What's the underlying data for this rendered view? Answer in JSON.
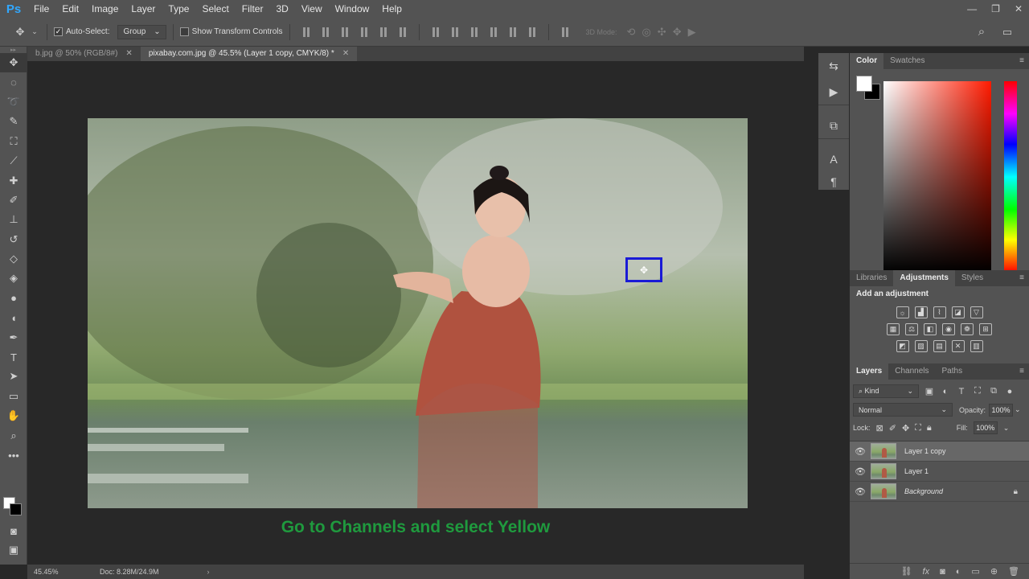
{
  "app": {
    "logo": "Ps"
  },
  "menubar": {
    "items": [
      "File",
      "Edit",
      "Image",
      "Layer",
      "Type",
      "Select",
      "Filter",
      "3D",
      "View",
      "Window",
      "Help"
    ]
  },
  "window_controls": {
    "minimize": "—",
    "restore": "❐",
    "close": "✕"
  },
  "options_bar": {
    "move_tool_icon": "✥",
    "auto_select_label": "Auto-Select:",
    "auto_select_checked": true,
    "auto_select_mode": "Group",
    "show_transform_label": "Show Transform Controls",
    "show_transform_checked": false,
    "mode_3d_label": "3D Mode:"
  },
  "tabs": [
    {
      "title": "b.jpg @ 50% (RGB/8#)",
      "close": "✕",
      "active": false
    },
    {
      "title": "pixabay.com.jpg @ 45.5% (Layer 1 copy, CMYK/8) *",
      "close": "✕",
      "active": true
    }
  ],
  "canvas": {
    "caption": "Go to Channels and select Yellow",
    "caption_color": "#1f9a3e",
    "marker_color": "#1a1ad6"
  },
  "statusbar": {
    "zoom": "45.45%",
    "doc": "Doc: 8.28M/24.9M",
    "arrow": "›"
  },
  "color_panel": {
    "tabs": [
      "Color",
      "Swatches"
    ],
    "active": "Color",
    "foreground": "#ffffff",
    "background": "#000000",
    "hue": "#ff1a00"
  },
  "adjustments_panel": {
    "tabs": [
      "Libraries",
      "Adjustments",
      "Styles"
    ],
    "active": "Adjustments",
    "title": "Add an adjustment"
  },
  "layers_panel": {
    "tabs": [
      "Layers",
      "Channels",
      "Paths"
    ],
    "active": "Layers",
    "kind_label": "Kind",
    "blend_mode": "Normal",
    "opacity_label": "Opacity:",
    "opacity": "100%",
    "lock_label": "Lock:",
    "fill_label": "Fill:",
    "fill": "100%",
    "layers": [
      {
        "name": "Layer 1 copy",
        "selected": true,
        "locked": false
      },
      {
        "name": "Layer 1",
        "selected": false,
        "locked": false
      },
      {
        "name": "Background",
        "selected": false,
        "locked": true
      }
    ]
  }
}
